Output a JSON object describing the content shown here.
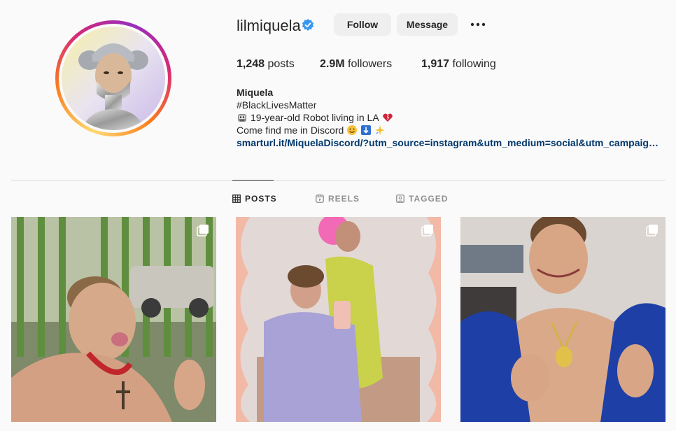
{
  "profile": {
    "username": "lilmiquela",
    "follow_label": "Follow",
    "message_label": "Message"
  },
  "stats": {
    "posts_count": "1,248",
    "posts_label": "posts",
    "followers_count": "2.9M",
    "followers_label": "followers",
    "following_count": "1,917",
    "following_label": "following"
  },
  "bio": {
    "name": "Miquela",
    "hashtag": "#BlackLivesMatter",
    "line1_emoji": "robot-face-icon",
    "line1_text": "19-year-old Robot living in LA",
    "line1_end_emoji": "heart-icon",
    "line2_text": "Come find me in Discord",
    "line2_emojis": [
      "smile-emoji",
      "down-arrow-emoji",
      "sparkle-emoji"
    ],
    "link": "smarturl.it/MiquelaDiscord/?utm_source=instagram&utm_medium=social&utm_campaign=bi..."
  },
  "tabs": [
    {
      "label": "POSTS",
      "icon": "grid-icon",
      "active": true
    },
    {
      "label": "REELS",
      "icon": "reels-icon",
      "active": false
    },
    {
      "label": "TAGGED",
      "icon": "tagged-icon",
      "active": false
    }
  ],
  "posts": [
    {
      "description_icon": "multiple-photos-icon"
    },
    {
      "description_icon": "multiple-photos-icon"
    },
    {
      "description_icon": "multiple-photos-icon"
    }
  ],
  "colors": {
    "background": "#fafafa",
    "link": "#00376b",
    "verified": "#3897f0",
    "button_bg": "#efefef"
  }
}
